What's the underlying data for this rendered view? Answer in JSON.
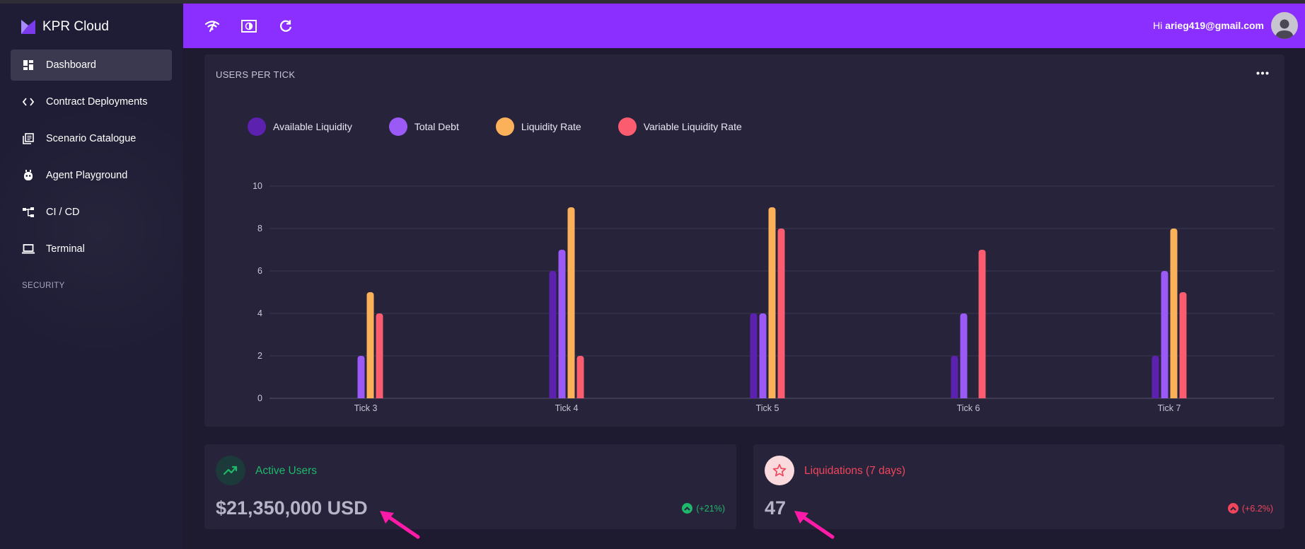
{
  "app": {
    "brand": "KPR Cloud"
  },
  "sidebar": {
    "items": [
      {
        "label": "Dashboard",
        "icon": "dashboard-icon",
        "active": true
      },
      {
        "label": "Contract Deployments",
        "icon": "code-icon"
      },
      {
        "label": "Scenario Catalogue",
        "icon": "library-icon"
      },
      {
        "label": "Agent Playground",
        "icon": "robot-icon"
      },
      {
        "label": "CI / CD",
        "icon": "account-tree-icon"
      },
      {
        "label": "Terminal",
        "icon": "laptop-icon"
      }
    ],
    "section": "SECURITY"
  },
  "topbar": {
    "icons": [
      "wifi-icon",
      "contrast-icon",
      "refresh-icon"
    ],
    "greeting": "Hi",
    "user": "arieg419@gmail.com"
  },
  "colors": {
    "accent": "#8a2fff",
    "available_liquidity": "#5d21b0",
    "total_debt": "#9b59f6",
    "liquidity_rate": "#fbb05a",
    "variable_liquidity_rate": "#fb5c6f",
    "positive": "#1fb86a",
    "negative": "#f0455b"
  },
  "chart_card": {
    "title": "USERS PER TICK"
  },
  "chart_data": {
    "type": "bar",
    "categories": [
      "Tick 3",
      "Tick 4",
      "Tick 5",
      "Tick 6",
      "Tick 7"
    ],
    "series": [
      {
        "name": "Available Liquidity",
        "values": [
          0,
          6,
          4,
          2,
          2
        ]
      },
      {
        "name": "Total Debt",
        "values": [
          2,
          7,
          4,
          4,
          6
        ]
      },
      {
        "name": "Liquidity Rate",
        "values": [
          5,
          9,
          9,
          0,
          8
        ]
      },
      {
        "name": "Variable Liquidity Rate",
        "values": [
          4,
          2,
          8,
          7,
          5
        ]
      }
    ],
    "yticks": [
      0,
      2,
      4,
      6,
      8,
      10
    ],
    "ylim": [
      0,
      10
    ],
    "grid": true,
    "legend_position": "top-left"
  },
  "stats": [
    {
      "label": "Active Users",
      "value": "$21,350,000 USD",
      "change": "(+21%)",
      "direction": "up",
      "icon": "trending-up-icon"
    },
    {
      "label": "Liquidations (7 days)",
      "value": "47",
      "change": "(+6.2%)",
      "direction": "up",
      "icon": "star-icon"
    }
  ]
}
